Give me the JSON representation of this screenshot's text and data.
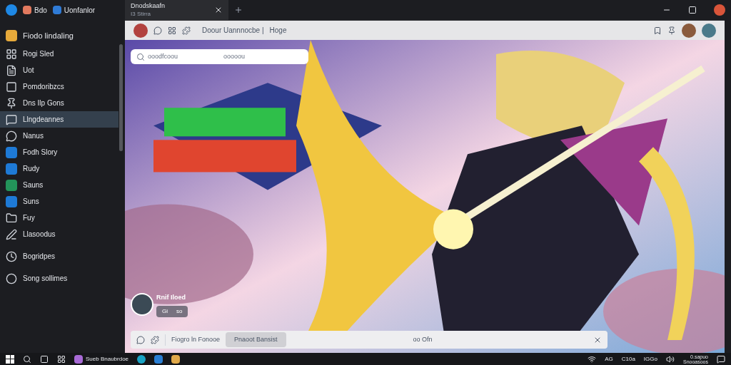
{
  "browser": {
    "pinned_tabs": [
      {
        "label": "Bdo"
      },
      {
        "label": "Uonfanlor"
      }
    ],
    "tabs": [
      {
        "title": "Dnodskaafn",
        "subtitle": "I3 Stirra",
        "selected": true
      }
    ]
  },
  "sidebar": {
    "header": "Fiodo lindaling",
    "items": [
      {
        "label": "Rogi Sled",
        "selected": false
      },
      {
        "label": "Uot",
        "selected": false
      },
      {
        "label": "Pomdoribzcs",
        "selected": false
      },
      {
        "label": "Dns Ilp Gons",
        "selected": false
      },
      {
        "label": "Llngdeannes",
        "selected": true
      },
      {
        "label": "Nanus",
        "selected": false
      },
      {
        "label": "Fodh Slory",
        "selected": false
      },
      {
        "label": "Rudy",
        "selected": false
      },
      {
        "label": "Sauns",
        "selected": false
      },
      {
        "label": "Suns",
        "selected": false
      },
      {
        "label": "Fuy",
        "selected": false
      },
      {
        "label": "Llasoodus",
        "selected": false
      },
      {
        "label": "Bogridpes",
        "selected": false
      },
      {
        "label": "Song sollimes",
        "selected": false
      }
    ]
  },
  "toolbar": {
    "address": "Doour Uannnocbe |",
    "link": "Hoge"
  },
  "search": {
    "placeholder": "ooodfcoou",
    "hint": "ooooou"
  },
  "profile_card": {
    "name": "Rnif Iloed",
    "count": "Gi",
    "extra": "so"
  },
  "bottom_bar": {
    "label": "Fiogro ln Fonooe",
    "button": "Pnaoot Bansist",
    "status": "oo Ofn"
  },
  "taskbar": {
    "app": "Sueb Bnaubrdoe",
    "tray": [
      "AG",
      "C10a",
      "IGGo"
    ],
    "clock": {
      "time": "0.sapuo",
      "date": "Snooasoos"
    }
  }
}
